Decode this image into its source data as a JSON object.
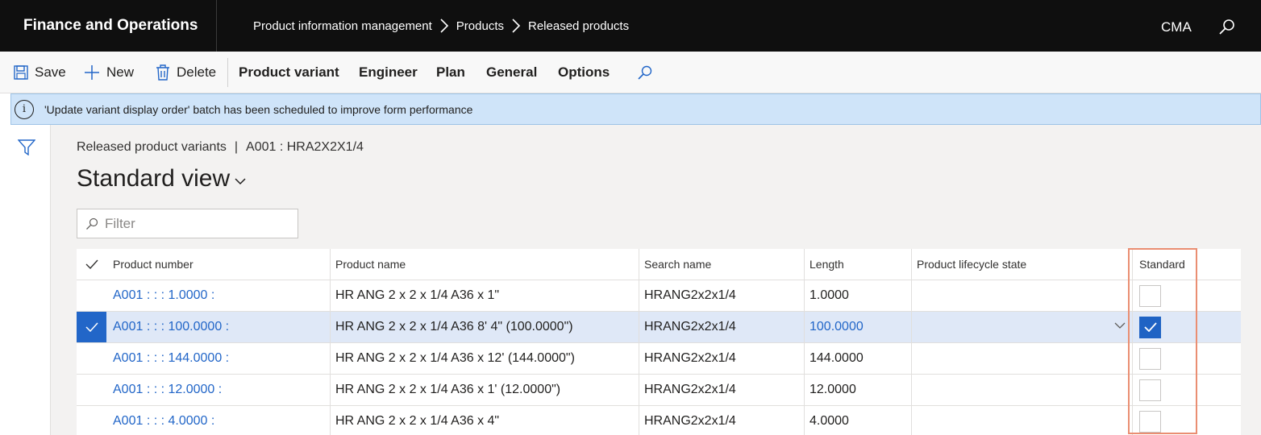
{
  "topbar": {
    "app_title": "Finance and Operations",
    "breadcrumbs": [
      "Product information management",
      "Products",
      "Released products"
    ],
    "company": "CMA"
  },
  "actions": {
    "save": "Save",
    "new": "New",
    "delete": "Delete",
    "product_variant": "Product variant",
    "engineer": "Engineer",
    "plan": "Plan",
    "general": "General",
    "options": "Options"
  },
  "message": "'Update variant display order' batch has been scheduled to improve form performance",
  "page": {
    "caption_left": "Released product variants",
    "caption_sep": "|",
    "caption_right": "A001 : HRA2X2X1/4",
    "view_name": "Standard view",
    "filter_placeholder": "Filter"
  },
  "grid": {
    "columns": [
      "Product number",
      "Product name",
      "Search name",
      "Length",
      "Product lifecycle state",
      "Standard"
    ],
    "rows": [
      {
        "number": "A001 :  :  : 1.0000 :",
        "name": "HR ANG 2 x 2 x 1/4 A36  x 1\"",
        "search": "HRANG2x2x1/4",
        "length": "1.0000",
        "lifecycle": "",
        "standard": false,
        "selected": false
      },
      {
        "number": "A001 :  :  : 100.0000 :",
        "name": "HR ANG 2 x 2 x 1/4 A36  8' 4\" (100.0000\")",
        "search": "HRANG2x2x1/4",
        "length": "100.0000",
        "lifecycle": "",
        "standard": true,
        "selected": true
      },
      {
        "number": "A001 :  :  : 144.0000 :",
        "name": "HR ANG 2 x 2 x 1/4 A36  x 12' (144.0000\")",
        "search": "HRANG2x2x1/4",
        "length": "144.0000",
        "lifecycle": "",
        "standard": false,
        "selected": false
      },
      {
        "number": "A001 :  :  : 12.0000 :",
        "name": "HR ANG 2 x 2 x 1/4 A36  x 1' (12.0000\")",
        "search": "HRANG2x2x1/4",
        "length": "12.0000",
        "lifecycle": "",
        "standard": false,
        "selected": false
      },
      {
        "number": "A001 :  :  : 4.0000 :",
        "name": "HR ANG 2 x 2 x 1/4 A36  x 4\"",
        "search": "HRANG2x2x1/4",
        "length": "4.0000",
        "lifecycle": "",
        "standard": false,
        "selected": false
      }
    ]
  },
  "colors": {
    "topbar_bg": "#0f0f0f",
    "link": "#2266c8",
    "selected_row": "#dfe8f7",
    "message_bg": "#cfe4f9",
    "highlight_border": "#ea8e72"
  }
}
